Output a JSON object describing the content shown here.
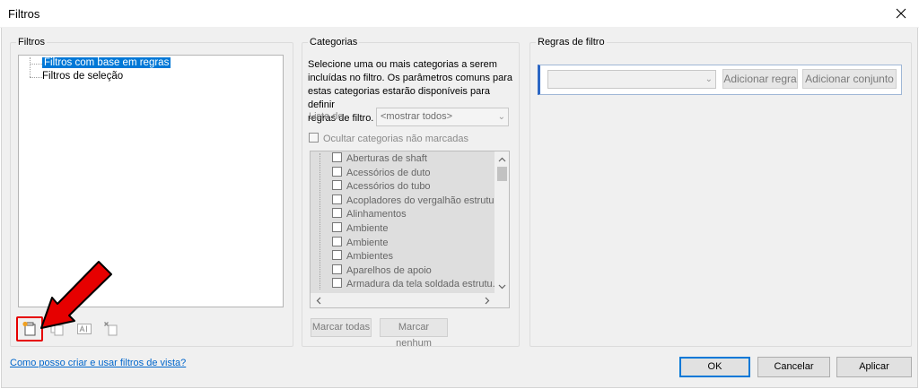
{
  "window": {
    "title": "Filtros"
  },
  "filters_panel": {
    "label": "Filtros",
    "tree": [
      {
        "label": "Filtros com base em regras",
        "selected": true
      },
      {
        "label": "Filtros de seleção",
        "selected": false
      }
    ],
    "toolbar_icons": [
      "new-filter-icon",
      "duplicate-icon",
      "rename-icon",
      "delete-icon"
    ]
  },
  "categories_panel": {
    "label": "Categorias",
    "description": [
      "Selecione uma ou mais categorias a serem",
      "incluídas no filtro. Os parâmetros comuns para",
      "estas categorias estarão disponíveis para definir",
      "regras de filtro."
    ],
    "list_label": "Lista de",
    "list_value": "<mostrar todos>",
    "hide_unchecked_label": "Ocultar categorias não marcadas",
    "items": [
      "Aberturas de shaft",
      "Acessórios de duto",
      "Acessórios do tubo",
      "Acopladores do vergalhão estrutu...",
      "Alinhamentos",
      "Ambiente",
      "Ambiente",
      "Ambientes",
      "Aparelhos de apoio",
      "Armadura da tela soldada estrutu..."
    ],
    "check_all_label": "Marcar todas",
    "check_none_label": "Marcar nenhum"
  },
  "rules_panel": {
    "label": "Regras de filtro",
    "add_rule_label": "Adicionar regra",
    "add_set_label": "Adicionar conjunto"
  },
  "footer": {
    "help_link": "Como posso criar e usar filtros de vista?",
    "ok_label": "OK",
    "cancel_label": "Cancelar",
    "apply_label": "Aplicar"
  },
  "colors": {
    "accent": "#0078d7",
    "highlight": "#e60000"
  }
}
